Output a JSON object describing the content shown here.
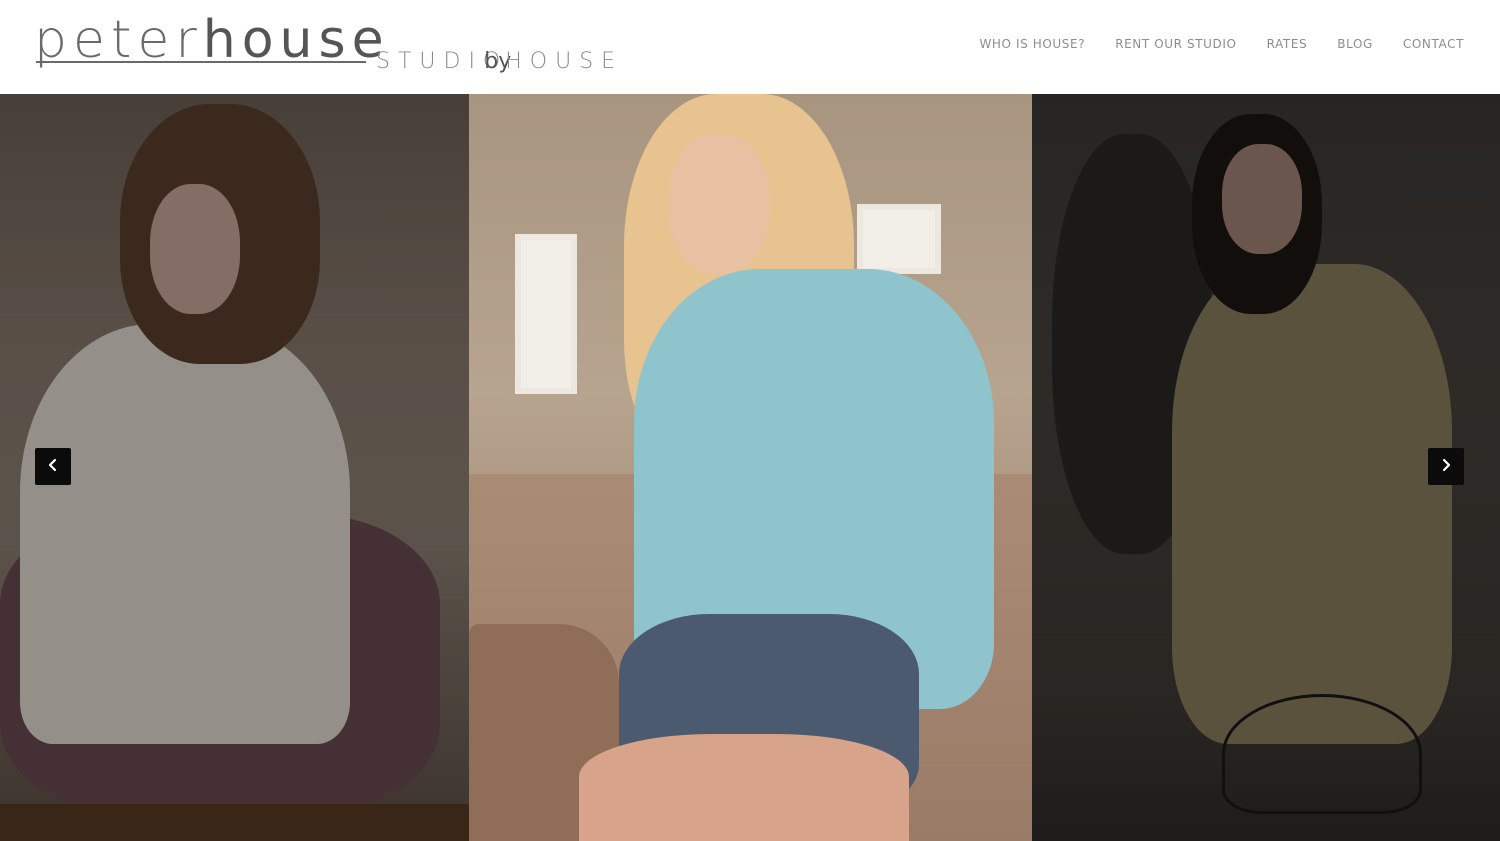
{
  "header": {
    "logo": {
      "peter": "peter",
      "house": "house",
      "studio": "STUDIO",
      "by": "by",
      "house_suffix": "HOUSE"
    },
    "nav": {
      "items": [
        {
          "label": "WHO IS HOUSE?"
        },
        {
          "label": "RENT OUR STUDIO"
        },
        {
          "label": "RATES"
        },
        {
          "label": "BLOG"
        },
        {
          "label": "CONTACT"
        }
      ]
    }
  },
  "slider": {
    "prev_icon": "chevron-left-icon",
    "next_icon": "chevron-right-icon",
    "slides": [
      {
        "name": "left-slide"
      },
      {
        "name": "center-slide"
      },
      {
        "name": "right-slide"
      }
    ]
  },
  "colors": {
    "nav_text": "#8d8d8d",
    "logo_text": "#6a6a6a",
    "arrow_bg": "#0b0b0b",
    "header_bg": "#ffffff"
  }
}
